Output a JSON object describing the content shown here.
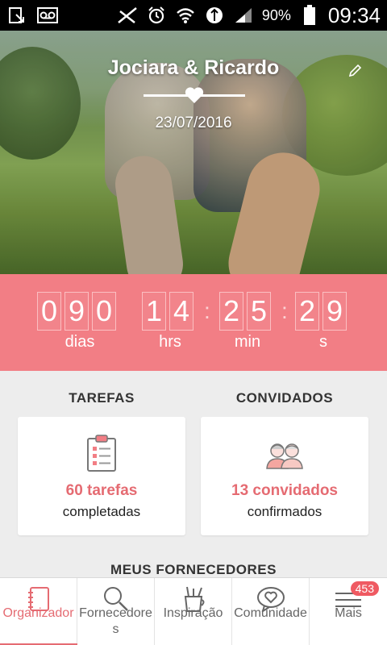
{
  "statusbar": {
    "battery": "90%",
    "time": "09:34"
  },
  "hero": {
    "couple_name": "Jociara & Ricardo",
    "wedding_date": "23/07/2016"
  },
  "countdown": {
    "days": [
      "0",
      "9",
      "0"
    ],
    "hours": [
      "1",
      "4"
    ],
    "minutes": [
      "2",
      "5"
    ],
    "seconds": [
      "2",
      "9"
    ],
    "separator": ":",
    "labels": {
      "days": "dias",
      "hours": "hrs",
      "minutes": "min",
      "seconds": "s"
    }
  },
  "tasks": {
    "title": "TAREFAS",
    "count": "60 tarefas",
    "sub": "completadas"
  },
  "guests": {
    "title": "CONVIDADOS",
    "count": "13 convidados",
    "sub": "confirmados"
  },
  "suppliers": {
    "title": "MEUS FORNECEDORES"
  },
  "nav": {
    "items": [
      {
        "label": "Organizador",
        "icon": "notebook-icon",
        "active": true
      },
      {
        "label": "Fornecedores",
        "icon": "search-icon",
        "active": false
      },
      {
        "label": "Inspiração",
        "icon": "pencil-cup-icon",
        "active": false
      },
      {
        "label": "Comunidade",
        "icon": "heart-bubble-icon",
        "active": false
      },
      {
        "label": "Mais",
        "icon": "menu-icon",
        "active": false,
        "badge": "453"
      }
    ]
  },
  "colors": {
    "accent": "#f27e85",
    "accent_text": "#e56b72"
  }
}
